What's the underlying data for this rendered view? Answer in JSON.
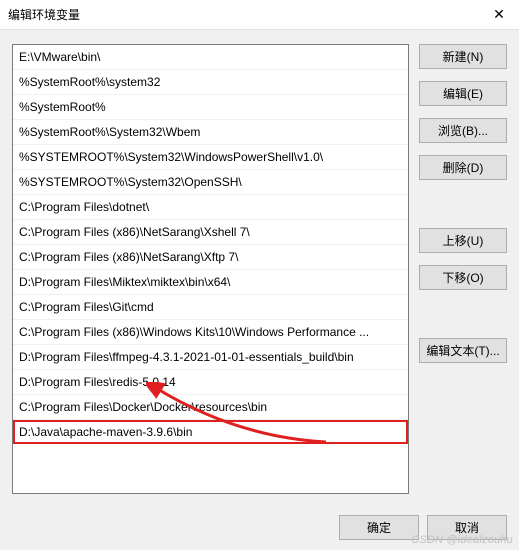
{
  "title": "编辑环境变量",
  "entries": [
    "E:\\VMware\\bin\\",
    "%SystemRoot%\\system32",
    "%SystemRoot%",
    "%SystemRoot%\\System32\\Wbem",
    "%SYSTEMROOT%\\System32\\WindowsPowerShell\\v1.0\\",
    "%SYSTEMROOT%\\System32\\OpenSSH\\",
    "C:\\Program Files\\dotnet\\",
    "C:\\Program Files (x86)\\NetSarang\\Xshell 7\\",
    "C:\\Program Files (x86)\\NetSarang\\Xftp 7\\",
    "D:\\Program Files\\Miktex\\miktex\\bin\\x64\\",
    "C:\\Program Files\\Git\\cmd",
    "C:\\Program Files (x86)\\Windows Kits\\10\\Windows Performance ...",
    "D:\\Program Files\\ffmpeg-4.3.1-2021-01-01-essentials_build\\bin",
    "D:\\Program Files\\redis-5.0.14",
    "C:\\Program Files\\Docker\\Docker\\resources\\bin",
    "D:\\Java\\apache-maven-3.9.6\\bin"
  ],
  "highlight_index": 15,
  "buttons": {
    "new": "新建(N)",
    "edit": "编辑(E)",
    "browse": "浏览(B)...",
    "delete": "删除(D)",
    "up": "上移(U)",
    "down": "下移(O)",
    "edit_text": "编辑文本(T)...",
    "ok": "确定",
    "cancel": "取消"
  },
  "watermark": "CSDN @idealzouhu"
}
